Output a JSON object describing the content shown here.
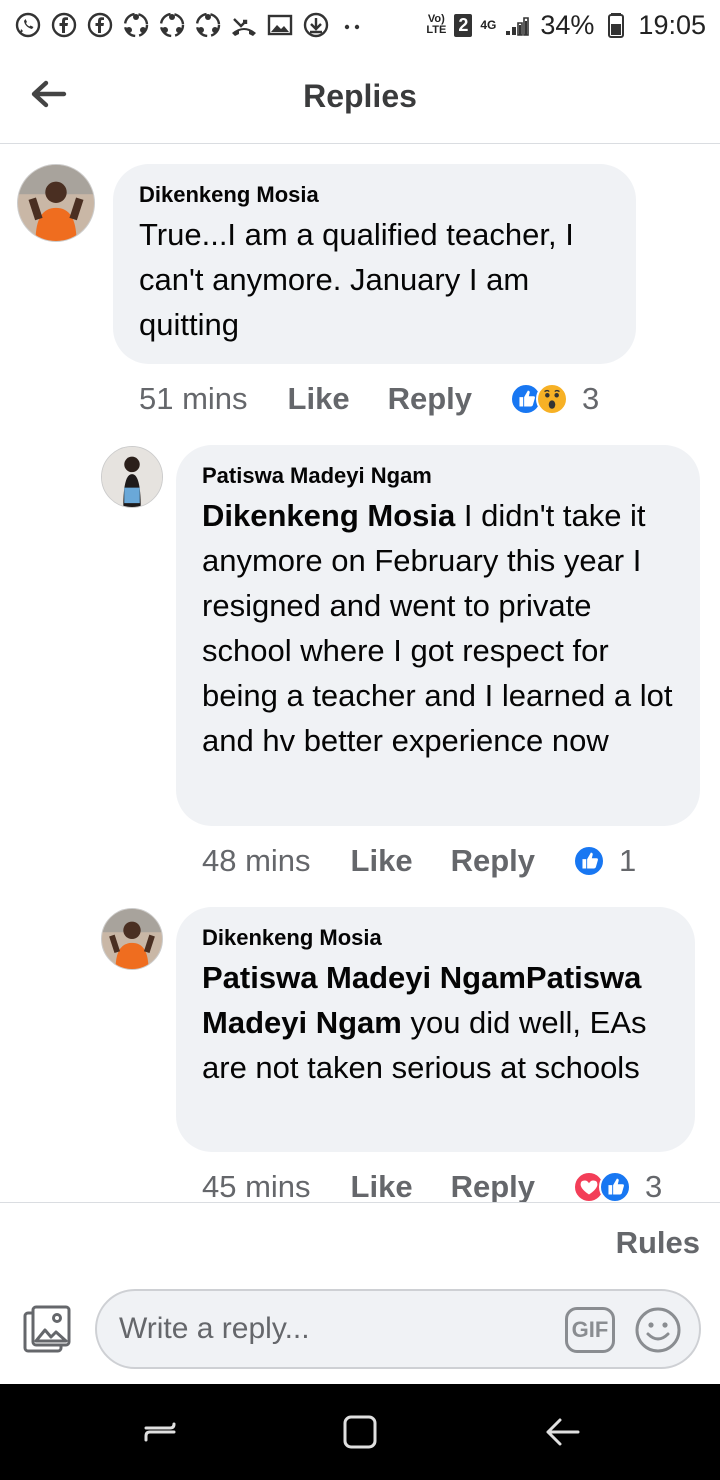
{
  "status_bar": {
    "volte_top": "Vo)",
    "volte_bottom": "LTE",
    "sim": "2",
    "network": "4G",
    "battery": "34%",
    "time": "19:05"
  },
  "header": {
    "title": "Replies"
  },
  "comments": [
    {
      "author": "Dikenkeng Mosia",
      "mention": "",
      "text": "True...I am a qualified teacher, I can't anymore. January I am quitting",
      "time": "51 mins",
      "like_label": "Like",
      "reply_label": "Reply",
      "reactions": [
        "like",
        "wow"
      ],
      "reaction_count": "3"
    },
    {
      "author": "Patiswa Madeyi Ngam",
      "mention": "Dikenkeng Mosia",
      "text": " I didn't take it anymore on February this year I resigned and went to private school where I got respect for being a teacher and I learned a lot and hv better experience now",
      "time": "48 mins",
      "like_label": "Like",
      "reply_label": "Reply",
      "reactions": [
        "like"
      ],
      "reaction_count": "1"
    },
    {
      "author": "Dikenkeng Mosia",
      "mention": "Patiswa Madeyi NgamPatiswa Madeyi Ngam",
      "text": " you did well, EAs are not taken serious at schools",
      "time": "45 mins",
      "like_label": "Like",
      "reply_label": "Reply",
      "reactions": [
        "love",
        "like"
      ],
      "reaction_count": "3"
    }
  ],
  "footer": {
    "rules_label": "Rules",
    "reply_placeholder": "Write a reply...",
    "gif_label": "GIF"
  },
  "colors": {
    "bubble": "#f0f2f5",
    "like_blue": "#1877f2",
    "love_red": "#f33e58",
    "muted_text": "#65676b"
  }
}
